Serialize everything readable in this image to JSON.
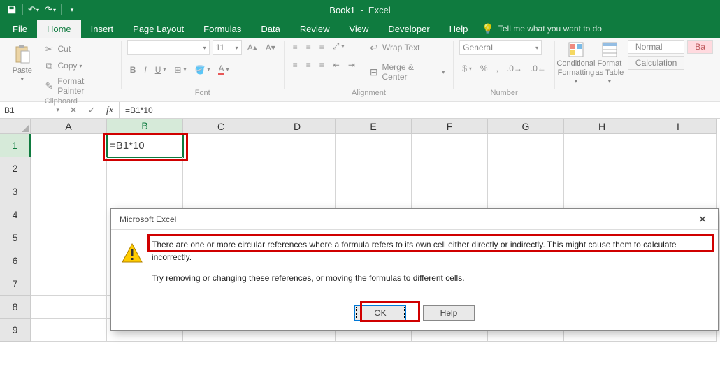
{
  "title": {
    "book": "Book1",
    "app": "Excel"
  },
  "tabs": [
    "File",
    "Home",
    "Insert",
    "Page Layout",
    "Formulas",
    "Data",
    "Review",
    "View",
    "Developer",
    "Help"
  ],
  "tellme": "Tell me what you want to do",
  "ribbon": {
    "clipboard": {
      "paste": "Paste",
      "cut": "Cut",
      "copy": "Copy",
      "painter": "Format Painter",
      "label": "Clipboard"
    },
    "font": {
      "name": "",
      "size": "11",
      "label": "Font"
    },
    "alignment": {
      "wrap": "Wrap Text",
      "merge": "Merge & Center",
      "label": "Alignment"
    },
    "number": {
      "format": "General",
      "label": "Number"
    },
    "styles": {
      "cond": "Conditional Formatting",
      "table": "Format as Table",
      "normal": "Normal",
      "bad": "Ba",
      "calc": "Calculation"
    }
  },
  "formulaBar": {
    "name": "B1",
    "formula": "=B1*10"
  },
  "columns": [
    "A",
    "B",
    "C",
    "D",
    "E",
    "F",
    "G",
    "H",
    "I"
  ],
  "rows": [
    "1",
    "2",
    "3",
    "4",
    "5",
    "6",
    "7",
    "8",
    "9"
  ],
  "activeCell": {
    "col": "B",
    "row": "1",
    "display": "=B1*10"
  },
  "dialog": {
    "title": "Microsoft Excel",
    "line1": "There are one or more circular references where a formula refers to its own cell either directly or indirectly. This might cause them to calculate incorrectly.",
    "line2": "Try removing or changing these references, or moving the formulas to different cells.",
    "ok": "OK",
    "help": "Help"
  }
}
